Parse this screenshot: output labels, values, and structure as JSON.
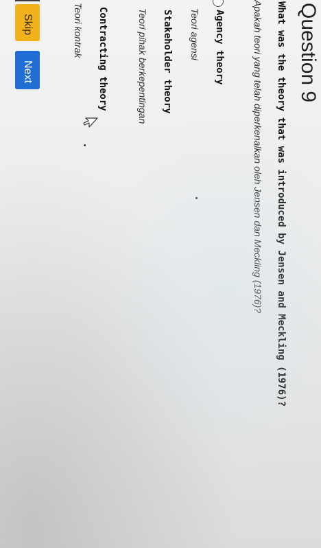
{
  "question": {
    "title": "Question 9",
    "text_en": "What was the theory that was introduced by Jensen and Meckling (1976)?",
    "text_id": "Apakah teori yang telah diperkenalkan oleh Jensen dan Meckling (1976)?"
  },
  "options": [
    {
      "label": "Agency theory",
      "translation": "Teori agensi"
    },
    {
      "label": "Stakeholder theory",
      "translation": "Teori pihak berkepentingan"
    },
    {
      "label": "Contracting theory",
      "translation": "Teori kontrak"
    }
  ],
  "buttons": {
    "skip": "Skip",
    "next": "Next"
  },
  "colors": {
    "skip_button": "#f2b21b",
    "next_button": "#1f6fd6"
  },
  "icons": {
    "cursor": "mouse-pointer-icon"
  }
}
